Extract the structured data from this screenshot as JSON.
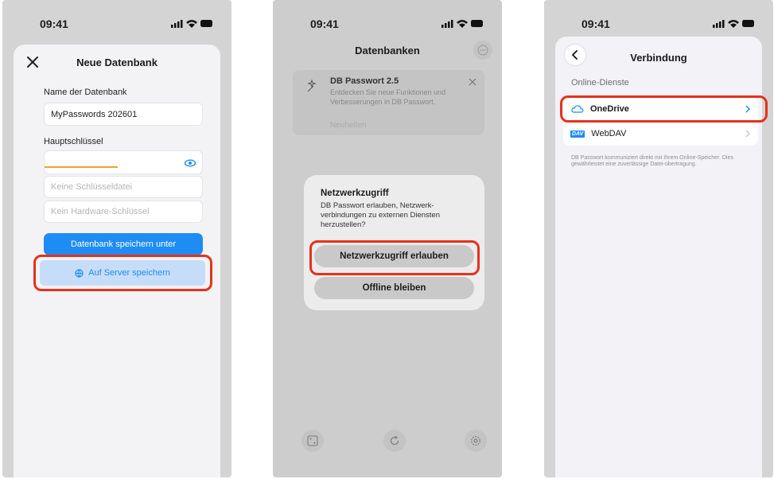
{
  "status": {
    "time": "09:41"
  },
  "screen1": {
    "title": "Neue Datenbank",
    "name_label": "Name der Datenbank",
    "name_value": "MyPasswords 202601",
    "master_label": "Hauptschlüssel",
    "keyfile_placeholder": "Keine Schlüsseldatei",
    "hardware_placeholder": "Kein Hardware-Schlüssel",
    "save_as_button": "Datenbank speichern unter",
    "server_button": "Auf Server speichern"
  },
  "screen2": {
    "title": "Datenbanken",
    "banner_title": "DB Passwort 2.5",
    "banner_text": "Entdecken Sie neue Funktionen und Verbesserungen in DB Passwort.",
    "banner_link": "Neuheiten",
    "dialog_title": "Netzwerkzugriff",
    "dialog_text": "DB Passwort erlauben, Netzwerk-verbindungen zu externen Diensten herzustellen?",
    "allow_button": "Netzwerkzugriff erlauben",
    "offline_button": "Offline bleiben"
  },
  "screen3": {
    "title": "Verbindung",
    "section_label": "Online-Dienste",
    "rows": [
      {
        "label": "OneDrive",
        "icon": "cloud-icon"
      },
      {
        "label": "WebDAV",
        "icon": "dav-icon",
        "badge": "DAV"
      }
    ],
    "footnote": "DB Passwort kommuniziert direkt mit Ihrem Online-Speicher. Dies gewährleistet eine zuverlässige Datei-übertragung."
  },
  "colors": {
    "accent": "#1e8cf5",
    "highlight": "#e6311c"
  }
}
